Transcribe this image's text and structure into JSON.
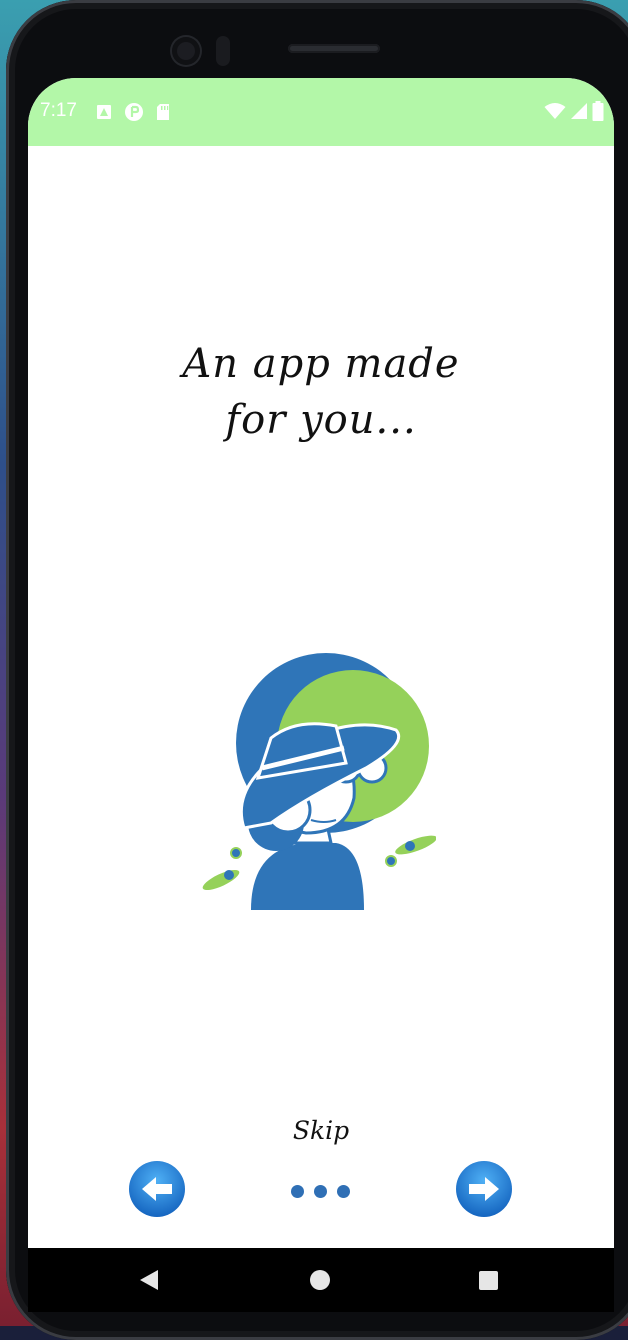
{
  "status_bar": {
    "time": "7:17",
    "left_icons": [
      "app-icon",
      "brand-icon",
      "sd-card-icon"
    ],
    "right_icons": [
      "wifi-icon",
      "signal-icon",
      "battery-icon"
    ],
    "color": "#b3f7a8"
  },
  "onboarding": {
    "headline_line1": "An app made",
    "headline_line2": "for you...",
    "illustration": "person-with-hat-illustration",
    "skip_label": "Skip",
    "page_indicator_count": 3,
    "prev_icon": "arrow-left-icon",
    "next_icon": "arrow-right-icon"
  },
  "system_nav": {
    "back": "back-icon",
    "home": "home-icon",
    "recents": "recents-icon"
  },
  "colors": {
    "accent_blue": "#2f75b8",
    "accent_green": "#95d15a",
    "button_blue": "#1e88e5"
  }
}
